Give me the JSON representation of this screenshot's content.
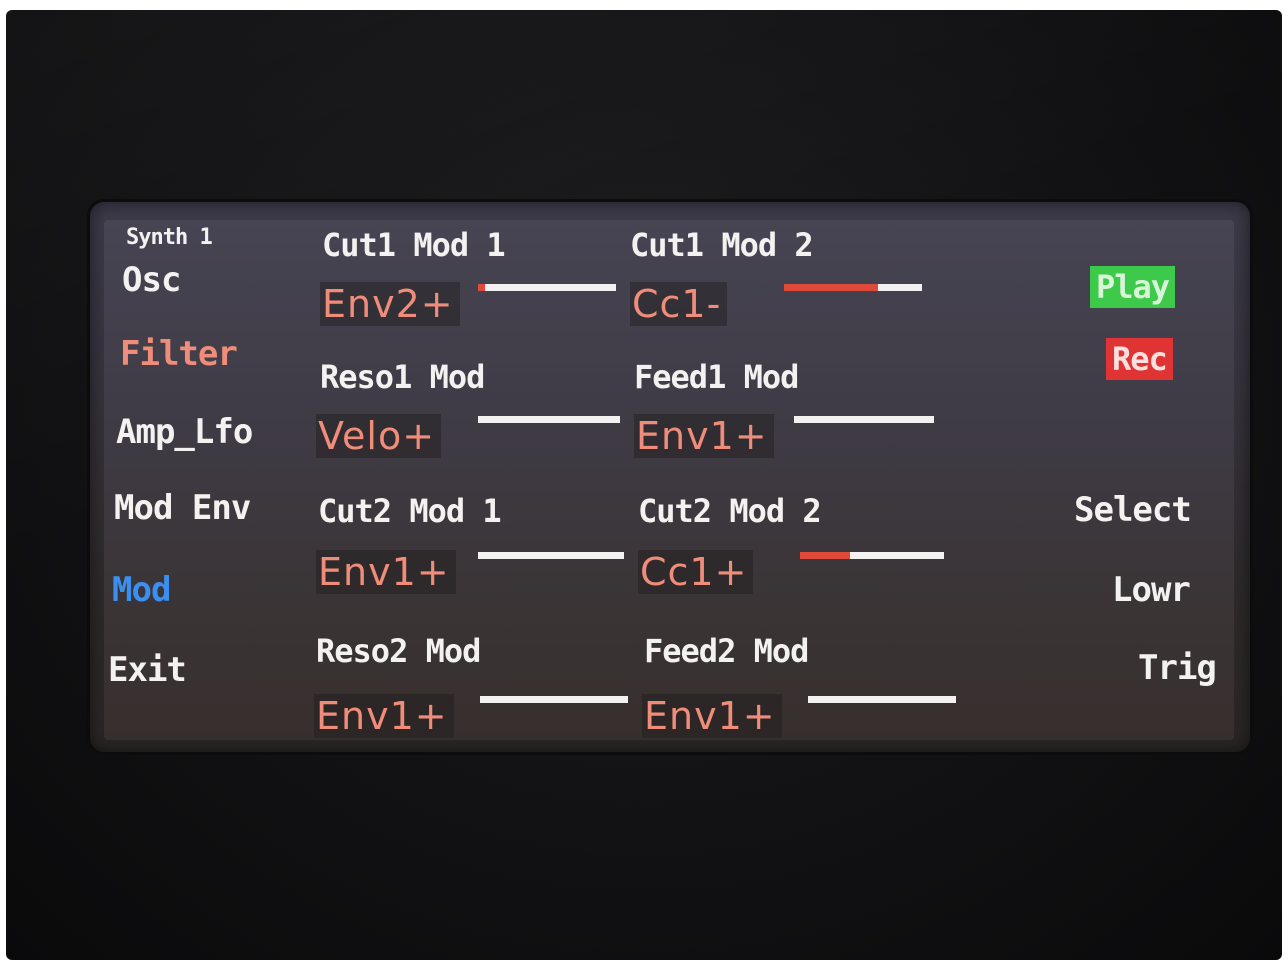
{
  "colors": {
    "accent_red": "#e04a3a",
    "value_salmon": "#f08d7a",
    "text_white": "#f4f2f0",
    "mod_blue": "#3b8ff0",
    "play_green": "#3dc94a",
    "rec_red": "#e03434"
  },
  "header": {
    "synth": "Synth 1"
  },
  "left_menu": {
    "osc": "Osc",
    "filter": "Filter",
    "amp_lfo": "Amp_Lfo",
    "mod_env": "Mod Env",
    "mod": "Mod",
    "exit": "Exit"
  },
  "right_menu": {
    "play": "Play",
    "rec": "Rec",
    "select": "Select",
    "lowr": "Lowr",
    "trig": "Trig"
  },
  "params": [
    {
      "label": "Cut1 Mod 1",
      "value": "Env2+",
      "amount": 0.05
    },
    {
      "label": "Cut1 Mod 2",
      "value": "Cc1-",
      "amount": 0.68
    },
    {
      "label": "Reso1 Mod",
      "value": "Velo+",
      "amount": 0.0
    },
    {
      "label": "Feed1 Mod",
      "value": "Env1+",
      "amount": 0.0
    },
    {
      "label": "Cut2 Mod 1",
      "value": "Env1+",
      "amount": 0.0
    },
    {
      "label": "Cut2 Mod 2",
      "value": "Cc1+",
      "amount": 0.35
    },
    {
      "label": "Reso2 Mod",
      "value": "Env1+",
      "amount": 0.0
    },
    {
      "label": "Feed2 Mod",
      "value": "Env1+",
      "amount": 0.0
    }
  ]
}
